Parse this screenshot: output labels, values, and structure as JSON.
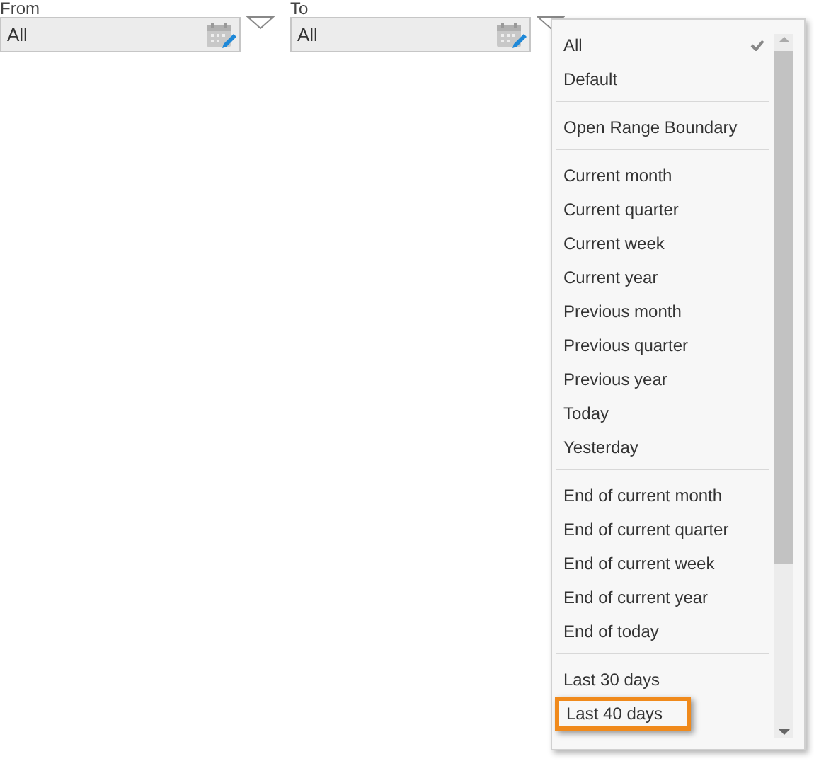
{
  "fields": [
    {
      "label": "From",
      "value": "All"
    },
    {
      "label": "To",
      "value": "All"
    }
  ],
  "menu": {
    "groups": [
      {
        "items": [
          {
            "label": "All",
            "selected": true,
            "highlighted": false
          },
          {
            "label": "Default",
            "selected": false,
            "highlighted": false
          }
        ]
      },
      {
        "items": [
          {
            "label": "Open Range Boundary",
            "selected": false,
            "highlighted": false
          }
        ]
      },
      {
        "items": [
          {
            "label": "Current month",
            "selected": false,
            "highlighted": false
          },
          {
            "label": "Current quarter",
            "selected": false,
            "highlighted": false
          },
          {
            "label": "Current week",
            "selected": false,
            "highlighted": false
          },
          {
            "label": "Current year",
            "selected": false,
            "highlighted": false
          },
          {
            "label": "Previous month",
            "selected": false,
            "highlighted": false
          },
          {
            "label": "Previous quarter",
            "selected": false,
            "highlighted": false
          },
          {
            "label": "Previous year",
            "selected": false,
            "highlighted": false
          },
          {
            "label": "Today",
            "selected": false,
            "highlighted": false
          },
          {
            "label": "Yesterday",
            "selected": false,
            "highlighted": false
          }
        ]
      },
      {
        "items": [
          {
            "label": "End of current month",
            "selected": false,
            "highlighted": false
          },
          {
            "label": "End of current quarter",
            "selected": false,
            "highlighted": false
          },
          {
            "label": "End of current week",
            "selected": false,
            "highlighted": false
          },
          {
            "label": "End of current year",
            "selected": false,
            "highlighted": false
          },
          {
            "label": "End of today",
            "selected": false,
            "highlighted": false
          }
        ]
      },
      {
        "items": [
          {
            "label": "Last 30 days",
            "selected": false,
            "highlighted": false
          },
          {
            "label": "Last 40 days",
            "selected": false,
            "highlighted": true
          }
        ]
      }
    ]
  }
}
